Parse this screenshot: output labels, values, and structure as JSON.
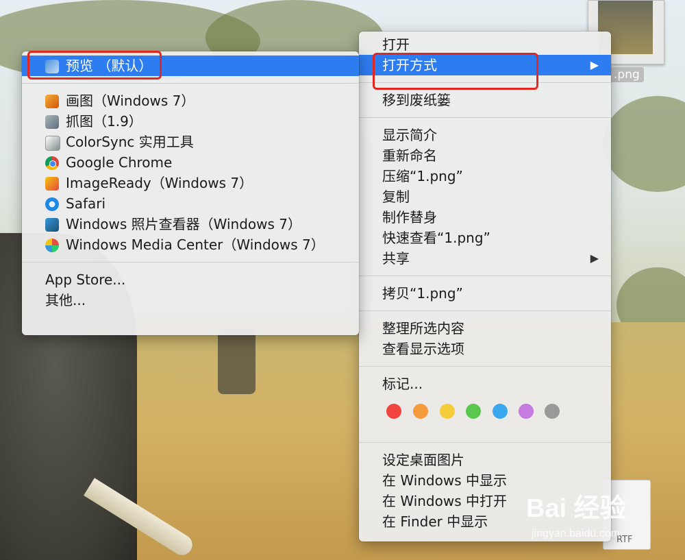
{
  "desktop": {
    "file_thumb_label": ".png",
    "file_icon_label": "RTF"
  },
  "submenu": {
    "default_app": "预览 （默认）",
    "apps": [
      {
        "name": "画图（Windows 7）",
        "icon": "paint-icon"
      },
      {
        "name": "抓图（1.9）",
        "icon": "grab-icon"
      },
      {
        "name": "ColorSync 实用工具",
        "icon": "colorsync-icon"
      },
      {
        "name": "Google Chrome",
        "icon": "chrome-icon"
      },
      {
        "name": "ImageReady（Windows 7）",
        "icon": "imageready-icon"
      },
      {
        "name": "Safari",
        "icon": "safari-icon"
      },
      {
        "name": "Windows 照片查看器（Windows 7）",
        "icon": "photo-viewer-icon"
      },
      {
        "name": "Windows Media Center（Windows 7）",
        "icon": "media-center-icon"
      }
    ],
    "app_store": "App Store...",
    "other": "其他..."
  },
  "context_menu": {
    "open": "打开",
    "open_with": "打开方式",
    "move_to_trash": "移到废纸篓",
    "get_info": "显示简介",
    "rename": "重新命名",
    "compress": "压缩“1.png”",
    "duplicate": "复制",
    "make_alias": "制作替身",
    "quick_look": "快速查看“1.png”",
    "share": "共享",
    "copy": "拷贝“1.png”",
    "clean_up": "整理所选内容",
    "view_options": "查看显示选项",
    "tags": "标记...",
    "tag_colors": [
      "#f0443e",
      "#f59a3d",
      "#f5cd3a",
      "#5bc74f",
      "#3ba7ee",
      "#c57be0",
      "#9a9a9a"
    ],
    "set_desktop": "设定桌面图片",
    "show_in_windows": "在 Windows 中显示",
    "open_in_windows": "在 Windows 中打开",
    "show_in_finder": "在 Finder 中显示"
  },
  "watermark": {
    "brand": "Bai  经验",
    "url": "jingyan.baidu.com"
  },
  "colors": {
    "selection": "#2d7cf0",
    "highlight_box": "#e3261f"
  }
}
